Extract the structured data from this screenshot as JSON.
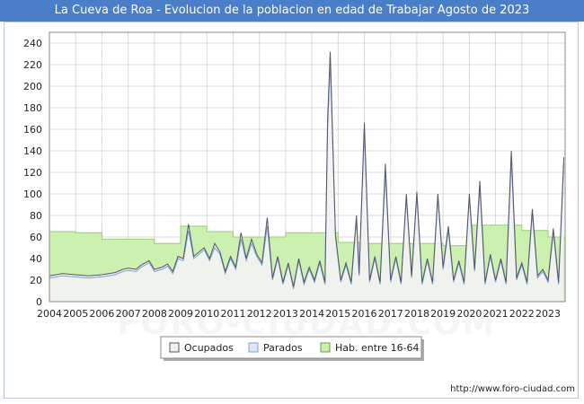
{
  "title": "La Cueva de Roa - Evolucion de la poblacion en edad de Trabajar Agosto de 2023",
  "footer": "http://www.foro-ciudad.com",
  "watermark": "FORO-CIUDAD.COM",
  "colors": {
    "title_bg": "#4a7ec9",
    "ocupados_fill": "#f2f2f2",
    "ocupados_line": "#555566",
    "parados_line": "#7aa0d8",
    "hab_fill": "#ccf0b0",
    "hab_line": "#99cc77",
    "grid": "#d8d8d8"
  },
  "chart_data": {
    "type": "area",
    "xlim": [
      2004,
      2023.65
    ],
    "ylim": [
      0,
      250
    ],
    "y_ticks": [
      0,
      20,
      40,
      60,
      80,
      100,
      120,
      140,
      160,
      180,
      200,
      220,
      240
    ],
    "x_ticks": [
      "2004",
      "2005",
      "2006",
      "2007",
      "2008",
      "2009",
      "2010",
      "2011",
      "2012",
      "2013",
      "2014",
      "2015",
      "2016",
      "2017",
      "2018",
      "2019",
      "2020",
      "2021",
      "2022",
      "2023"
    ],
    "grid": true,
    "legend_position": "bottom",
    "series": [
      {
        "name": "Ocupados",
        "style": "area",
        "x": [
          2004.0,
          2004.5,
          2005.0,
          2005.5,
          2006.0,
          2006.5,
          2006.8,
          2007.0,
          2007.3,
          2007.5,
          2007.8,
          2008.0,
          2008.3,
          2008.5,
          2008.7,
          2008.9,
          2009.1,
          2009.3,
          2009.5,
          2009.7,
          2009.9,
          2010.1,
          2010.3,
          2010.5,
          2010.7,
          2010.9,
          2011.1,
          2011.3,
          2011.5,
          2011.7,
          2011.9,
          2012.1,
          2012.3,
          2012.5,
          2012.7,
          2012.9,
          2013.1,
          2013.3,
          2013.5,
          2013.7,
          2013.9,
          2014.1,
          2014.3,
          2014.5,
          2014.6,
          2014.7,
          2014.9,
          2015.1,
          2015.3,
          2015.5,
          2015.7,
          2015.8,
          2016.0,
          2016.2,
          2016.4,
          2016.6,
          2016.8,
          2017.0,
          2017.2,
          2017.4,
          2017.6,
          2017.8,
          2018.0,
          2018.2,
          2018.4,
          2018.6,
          2018.8,
          2019.0,
          2019.2,
          2019.4,
          2019.6,
          2019.8,
          2020.0,
          2020.2,
          2020.4,
          2020.6,
          2020.8,
          2021.0,
          2021.2,
          2021.4,
          2021.6,
          2021.8,
          2022.0,
          2022.2,
          2022.4,
          2022.6,
          2022.8,
          2023.0,
          2023.2,
          2023.4,
          2023.6
        ],
        "y": [
          24,
          26,
          25,
          24,
          25,
          27,
          30,
          31,
          30,
          34,
          38,
          30,
          32,
          35,
          28,
          42,
          40,
          72,
          42,
          46,
          50,
          40,
          54,
          46,
          28,
          42,
          32,
          64,
          40,
          58,
          44,
          36,
          78,
          22,
          42,
          18,
          36,
          14,
          40,
          18,
          32,
          20,
          38,
          18,
          170,
          232,
          62,
          20,
          36,
          18,
          80,
          26,
          166,
          20,
          42,
          18,
          128,
          20,
          42,
          18,
          100,
          24,
          102,
          18,
          40,
          18,
          100,
          32,
          70,
          20,
          38,
          18,
          100,
          30,
          112,
          18,
          44,
          20,
          40,
          18,
          140,
          22,
          36,
          18,
          86,
          24,
          30,
          20,
          68,
          18,
          134
        ]
      },
      {
        "name": "Parados",
        "style": "line",
        "x": [
          2004.0,
          2004.5,
          2005.0,
          2005.5,
          2006.0,
          2006.5,
          2006.8,
          2007.0,
          2007.3,
          2007.5,
          2007.8,
          2008.0,
          2008.3,
          2008.5,
          2008.7,
          2008.9,
          2009.1,
          2009.3,
          2009.5,
          2009.7,
          2009.9,
          2010.1,
          2010.3,
          2010.5,
          2010.7,
          2010.9,
          2011.1,
          2011.3,
          2011.5,
          2011.7,
          2011.9,
          2012.1,
          2012.3,
          2012.5,
          2012.7,
          2012.9,
          2013.1,
          2013.3,
          2013.5,
          2013.7,
          2013.9,
          2014.1,
          2014.3,
          2014.5,
          2014.6,
          2014.7,
          2014.9,
          2015.1,
          2015.3,
          2015.5,
          2015.7,
          2015.8,
          2016.0,
          2016.2,
          2016.4,
          2016.6,
          2016.8,
          2017.0,
          2017.2,
          2017.4,
          2017.6,
          2017.8,
          2018.0,
          2018.2,
          2018.4,
          2018.6,
          2018.8,
          2019.0,
          2019.2,
          2019.4,
          2019.6,
          2019.8,
          2020.0,
          2020.2,
          2020.4,
          2020.6,
          2020.8,
          2021.0,
          2021.2,
          2021.4,
          2021.6,
          2021.8,
          2022.0,
          2022.2,
          2022.4,
          2022.6,
          2022.8,
          2023.0,
          2023.2,
          2023.4,
          2023.6
        ],
        "y": [
          22,
          24,
          23,
          22,
          23,
          25,
          28,
          29,
          28,
          32,
          36,
          28,
          30,
          33,
          26,
          40,
          38,
          66,
          40,
          44,
          48,
          38,
          50,
          44,
          26,
          40,
          30,
          58,
          38,
          54,
          42,
          34,
          70,
          20,
          40,
          16,
          34,
          12,
          38,
          16,
          30,
          18,
          36,
          16,
          160,
          222,
          60,
          18,
          34,
          16,
          76,
          24,
          158,
          18,
          40,
          16,
          120,
          18,
          40,
          16,
          96,
          22,
          98,
          16,
          38,
          16,
          96,
          30,
          66,
          18,
          36,
          16,
          96,
          28,
          106,
          16,
          42,
          18,
          38,
          16,
          132,
          20,
          34,
          16,
          82,
          22,
          28,
          18,
          64,
          16,
          128
        ]
      },
      {
        "name": "Hab. entre 16-64",
        "style": "step",
        "x": [
          2004.0,
          2005.0,
          2006.0,
          2007.0,
          2008.0,
          2009.0,
          2010.0,
          2011.0,
          2012.0,
          2013.0,
          2014.0,
          2015.0,
          2016.0,
          2017.0,
          2018.0,
          2019.0,
          2020.0,
          2021.0,
          2022.0,
          2023.0,
          2023.65
        ],
        "y": [
          65,
          64,
          58,
          58,
          54,
          70,
          65,
          60,
          60,
          64,
          64,
          55,
          54,
          54,
          54,
          52,
          71,
          71,
          66,
          60,
          60
        ]
      }
    ]
  }
}
